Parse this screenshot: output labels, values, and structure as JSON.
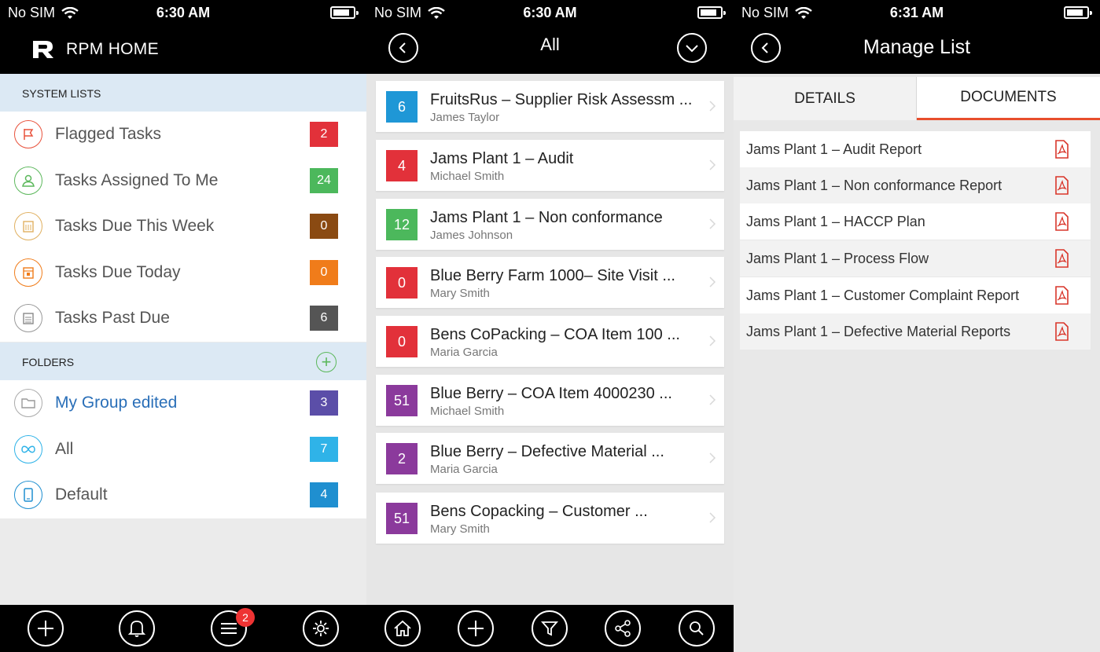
{
  "screen1": {
    "status": {
      "carrier": "No SIM",
      "time": "6:30 AM"
    },
    "app_title": "RPM HOME",
    "system_lists": {
      "heading": "SYSTEM LISTS",
      "items": [
        {
          "label": "Flagged Tasks",
          "count": "2",
          "color": "#e2313a",
          "icon": "flag-icon",
          "icon_color": "#e8523c"
        },
        {
          "label": "Tasks Assigned To Me",
          "count": "24",
          "color": "#4cb85c",
          "icon": "user-icon",
          "icon_color": "#5cb85c"
        },
        {
          "label": "Tasks Due This Week",
          "count": "0",
          "color": "#8a4a12",
          "icon": "calendar-week-icon",
          "icon_color": "#e0b060"
        },
        {
          "label": "Tasks Due Today",
          "count": "0",
          "color": "#f07c1a",
          "icon": "calendar-today-icon",
          "icon_color": "#f07c1a"
        },
        {
          "label": "Tasks Past Due",
          "count": "6",
          "color": "#555555",
          "icon": "calendar-past-icon",
          "icon_color": "#888888"
        }
      ]
    },
    "folders": {
      "heading": "FOLDERS",
      "items": [
        {
          "label": "My Group edited",
          "count": "3",
          "color": "#5b4ea8",
          "icon": "folder-icon",
          "icon_color": "#aaaaaa",
          "label_color": "#2a6fb8"
        },
        {
          "label": "All",
          "count": "7",
          "color": "#2fb3e8",
          "icon": "infinity-icon",
          "icon_color": "#2fb3e8",
          "label_color": "#555555"
        },
        {
          "label": "Default",
          "count": "4",
          "color": "#1f8fd0",
          "icon": "tablet-icon",
          "icon_color": "#1f8fd0",
          "label_color": "#555555"
        }
      ]
    },
    "tabbar": {
      "notifications_badge": "2"
    }
  },
  "screen2": {
    "status": {
      "carrier": "No SIM",
      "time": "6:30 AM"
    },
    "title": "All",
    "tasks": [
      {
        "count": "6",
        "color": "#1f97d6",
        "title": "FruitsRus – Supplier Risk Assessm ...",
        "assignee": "James Taylor"
      },
      {
        "count": "4",
        "color": "#e2313a",
        "title": "Jams Plant 1 – Audit",
        "assignee": "Michael Smith"
      },
      {
        "count": "12",
        "color": "#4cb85c",
        "title": "Jams Plant 1 – Non conformance",
        "assignee": "James Johnson"
      },
      {
        "count": "0",
        "color": "#e2313a",
        "title": "Blue Berry Farm 1000– Site Visit ...",
        "assignee": "Mary Smith"
      },
      {
        "count": "0",
        "color": "#e2313a",
        "title": "Bens CoPacking – COA Item 100 ...",
        "assignee": "Maria Garcia"
      },
      {
        "count": "51",
        "color": "#8b3a9c",
        "title": "Blue Berry  – COA Item 4000230 ...",
        "assignee": "Michael Smith"
      },
      {
        "count": "2",
        "color": "#8b3a9c",
        "title": "Blue Berry – Defective Material ...",
        "assignee": "Maria Garcia"
      },
      {
        "count": "51",
        "color": "#8b3a9c",
        "title": "Bens Copacking – Customer ...",
        "assignee": "Mary Smith"
      }
    ]
  },
  "screen3": {
    "status": {
      "carrier": "No SIM",
      "time": "6:31 AM"
    },
    "title": "Manage List",
    "tabs": {
      "details": "DETAILS",
      "documents": "DOCUMENTS"
    },
    "accent": "#e84e2c",
    "documents": [
      "Jams Plant 1 – Audit Report",
      "Jams Plant 1 – Non conformance Report",
      "Jams Plant 1 – HACCP Plan",
      "Jams Plant 1 – Process Flow",
      "Jams Plant 1 – Customer Complaint Report",
      "Jams Plant 1 – Defective Material Reports"
    ]
  }
}
